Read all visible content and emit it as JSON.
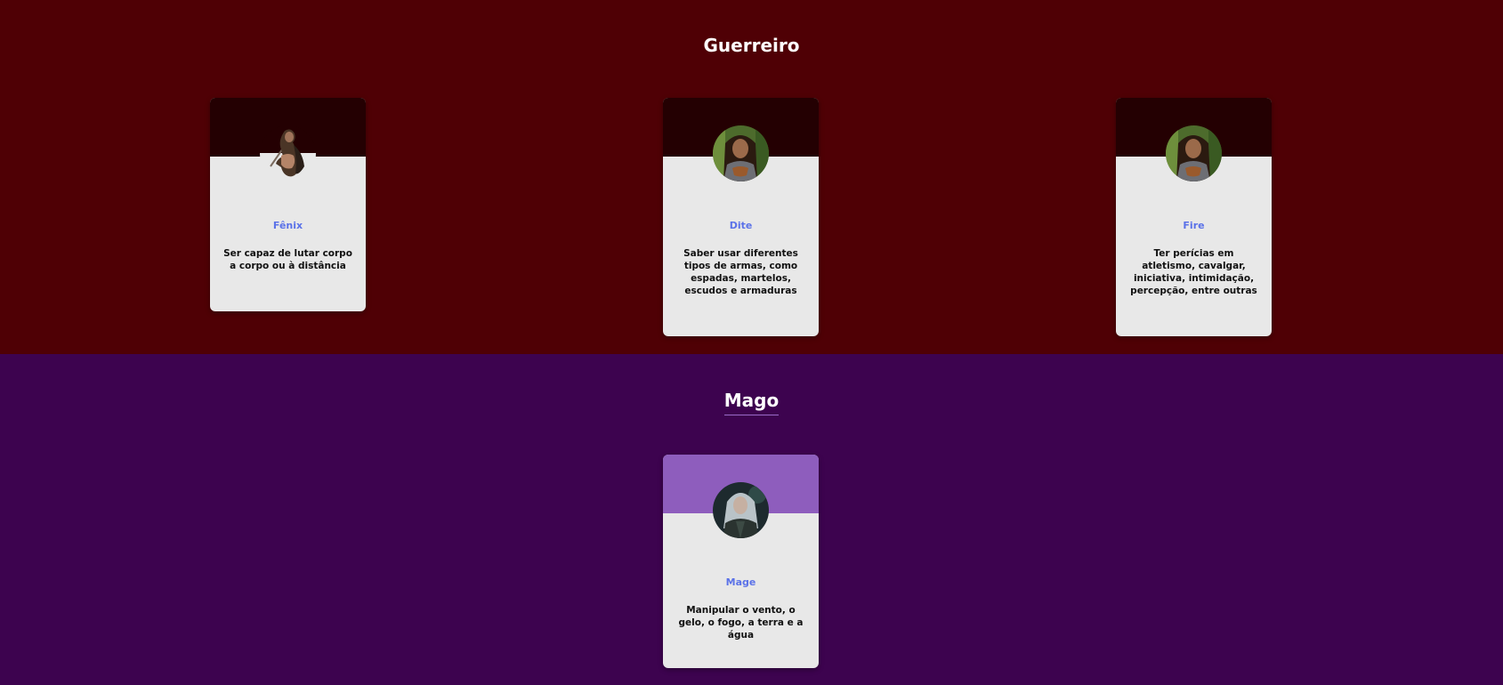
{
  "sections": {
    "guerreiro": {
      "title": "Guerreiro",
      "cards": [
        {
          "name": "Fênix",
          "description": "Ser capaz de lutar corpo a corpo ou à distância",
          "avatar_icon": "warrior-woman-sword-icon"
        },
        {
          "name": "Dite",
          "description": "Saber usar diferentes tipos de armas, como espadas, martelos, escudos e armaduras",
          "avatar_icon": "elf-warrior-portrait-icon"
        },
        {
          "name": "Fire",
          "description": "Ter perícias em atletismo, cavalgar, iniciativa, intimidação, percepção, entre outras",
          "avatar_icon": "elf-warrior-portrait-icon"
        }
      ]
    },
    "mago": {
      "title": "Mago",
      "cards": [
        {
          "name": "Mage",
          "description": "Manipular o vento, o gelo, o fogo, a terra e a água",
          "avatar_icon": "silver-haired-mage-portrait-icon"
        }
      ]
    }
  },
  "colors": {
    "guerreiro_bg": "#4f0005",
    "guerreiro_card_header": "#240002",
    "mago_bg": "#3d034f",
    "mago_card_header": "#8e5dbd",
    "card_body": "#e8e8e8",
    "card_name": "#5b72e8"
  }
}
